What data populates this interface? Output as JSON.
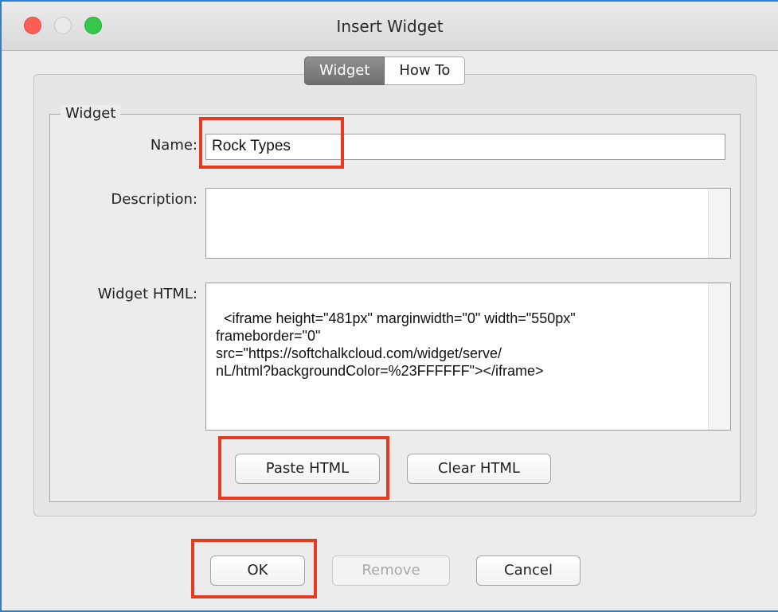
{
  "window": {
    "title": "Insert Widget"
  },
  "tabs": [
    {
      "label": "Widget",
      "selected": true
    },
    {
      "label": "How To",
      "selected": false
    }
  ],
  "group": {
    "label": "Widget"
  },
  "form": {
    "name_label": "Name:",
    "name_value": "Rock Types",
    "description_label": "Description:",
    "description_value": "",
    "html_label": "Widget HTML:",
    "html_value": "<iframe height=\"481px\" marginwidth=\"0\" width=\"550px\"\nframeborder=\"0\"\nsrc=\"https://softchalkcloud.com/widget/serve/\nnL/html?backgroundColor=%23FFFFFF\"></iframe>"
  },
  "buttons": {
    "paste_html": "Paste HTML",
    "clear_html": "Clear HTML",
    "ok": "OK",
    "remove": "Remove",
    "cancel": "Cancel"
  },
  "colors": {
    "highlight": "#e8391e",
    "window_border": "#2a7fd0",
    "close": "#fc5f57",
    "minimize": "#e9e9e9",
    "maximize": "#34c749"
  }
}
